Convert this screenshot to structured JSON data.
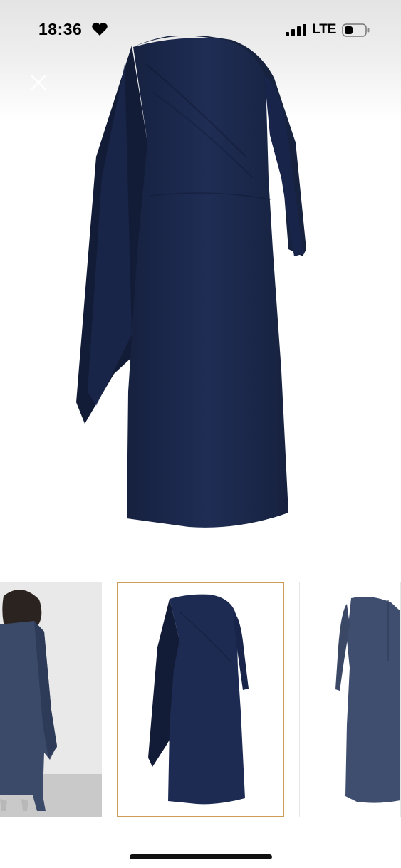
{
  "status_bar": {
    "time": "18:36",
    "network": "LTE",
    "icons": [
      "heart-icon",
      "signal-bars-icon",
      "battery-icon"
    ]
  },
  "gallery": {
    "close_icon": "close-icon",
    "selected_index": 2,
    "thumbnails": [
      "thumbnail-model-back-view",
      "thumbnail-dress-front-view",
      "thumbnail-dress-back-view"
    ]
  },
  "colors": {
    "dress": "#1c2a4f",
    "dress_back_view": "#3f4e6e",
    "selected_thumbnail_border": "#d09a57"
  }
}
